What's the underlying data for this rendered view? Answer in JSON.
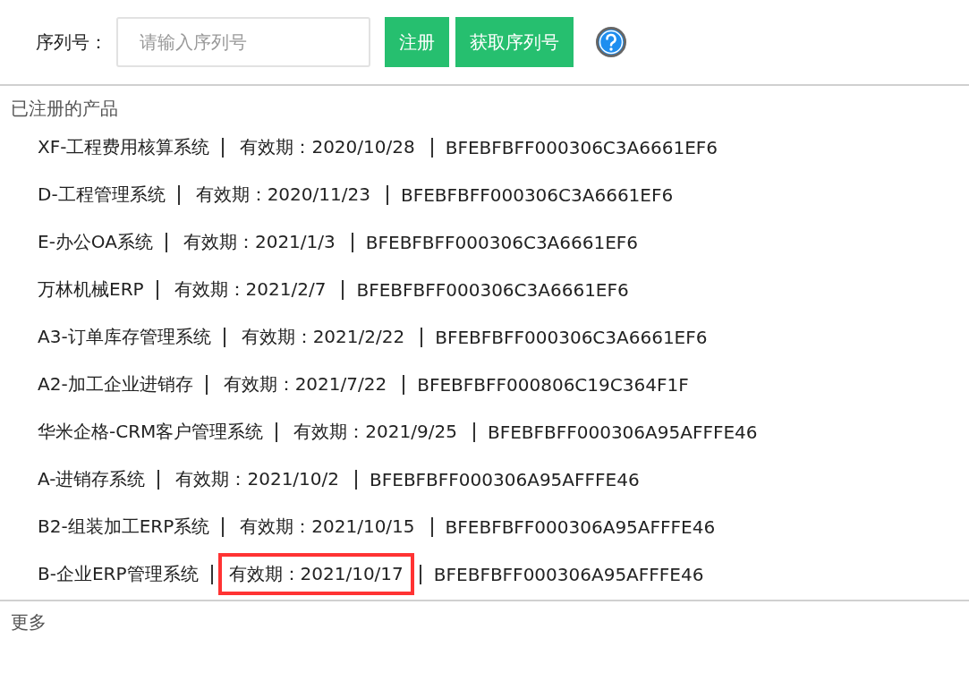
{
  "register_bar": {
    "label": "序列号：",
    "serial_field": {
      "placeholder": "请输入序列号"
    },
    "buttons": [
      "注册",
      "获取序列号"
    ]
  },
  "registered_products": {
    "title": "已注册的产品",
    "items": [
      {
        "name": "XF-工程费用核算系统",
        "expiry": "有效期：2020/10/28",
        "serial": "BFEBFBFF000306C3A6661EF6",
        "highlighted": false
      },
      {
        "name": "D-工程管理系统",
        "expiry": "有效期：2020/11/23",
        "serial": "BFEBFBFF000306C3A6661EF6",
        "highlighted": false
      },
      {
        "name": "E-办公OA系统",
        "expiry": "有效期：2021/1/3",
        "serial": "BFEBFBFF000306C3A6661EF6",
        "highlighted": false
      },
      {
        "name": "万林机械ERP",
        "expiry": "有效期：2021/2/7",
        "serial": "BFEBFBFF000306C3A6661EF6",
        "highlighted": false
      },
      {
        "name": "A3-订单库存管理系统",
        "expiry": "有效期：2021/2/22",
        "serial": "BFEBFBFF000306C3A6661EF6",
        "highlighted": false
      },
      {
        "name": "A2-加工企业进销存",
        "expiry": "有效期：2021/7/22",
        "serial": "BFEBFBFF000806C19C364F1F",
        "highlighted": false
      },
      {
        "name": "华米企格-CRM客户管理系统",
        "expiry": "有效期：2021/9/25",
        "serial": "BFEBFBFF000306A95AFFFE46",
        "highlighted": false
      },
      {
        "name": "A-进销存系统",
        "expiry": "有效期：2021/10/2",
        "serial": "BFEBFBFF000306A95AFFFE46",
        "highlighted": false
      },
      {
        "name": "B2-组装加工ERP系统",
        "expiry": "有效期：2021/10/15",
        "serial": "BFEBFBFF000306A95AFFFE46",
        "highlighted": false
      },
      {
        "name": "B-企业ERP管理系统",
        "expiry": "有效期：2021/10/17",
        "serial": "BFEBFBFF000306A95AFFFE46",
        "highlighted": true
      }
    ]
  },
  "more": {
    "title": "更多"
  }
}
